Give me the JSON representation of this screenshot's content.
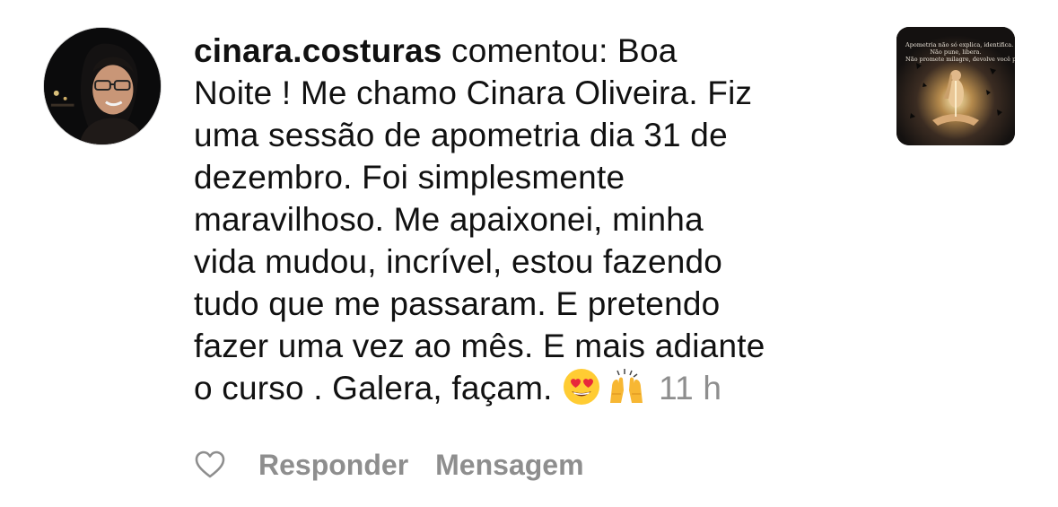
{
  "comment": {
    "username": "cinara.costuras",
    "verb": " comentou: Boa",
    "lines": [
      "Noite ! Me chamo Cinara Oliveira.  Fiz",
      "uma sessão de apometria dia 31 de",
      "dezembro.  Foi simplesmente",
      "maravilhoso.  Me apaixonei, minha",
      "vida mudou, incrível, estou fazendo",
      "tudo que me passaram. E pretendo",
      "fazer uma vez ao mês.  E mais adiante"
    ],
    "last_line": "o curso . Galera, façam. ",
    "emojis": [
      "heart-eyes-emoji",
      "raising-hands-emoji"
    ],
    "timestamp": "11 h"
  },
  "avatar": {
    "icon": "profile-photo"
  },
  "post_thumbnail": {
    "icon": "post-thumbnail",
    "caption_lines": [
      "Apometria não só explica, identifica.",
      "Não pune, libera.",
      "Não promete milagre, devolve você para você."
    ]
  },
  "actions": {
    "like_icon": "heart-outline-icon",
    "reply_label": "Responder",
    "message_label": "Mensagem"
  },
  "colors": {
    "text": "#111111",
    "muted": "#8e8e8e",
    "background": "#ffffff"
  }
}
